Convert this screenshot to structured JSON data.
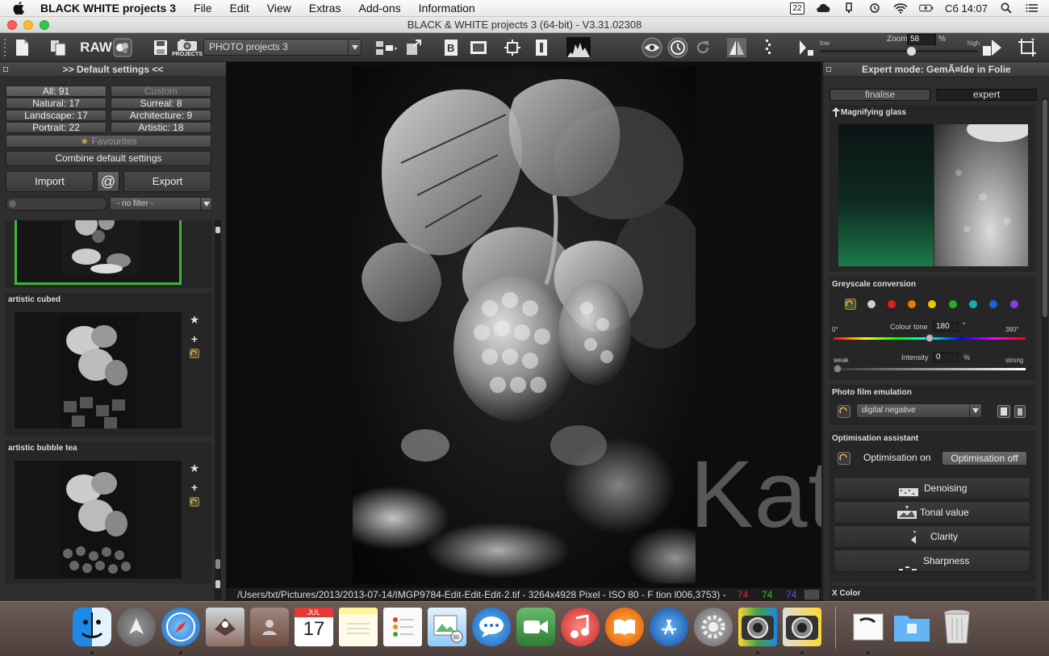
{
  "menubar": {
    "app_name": "BLACK WHITE projects 3",
    "items": [
      "File",
      "Edit",
      "View",
      "Extras",
      "Add-ons",
      "Information"
    ],
    "badge": "22",
    "clock": "Сб 14:07"
  },
  "window": {
    "title": "BLACK & WHITE projects 3 (64-bit) - V3.31.02308"
  },
  "toolbar": {
    "raw_label": "RAW",
    "projects_label": "PROJECTS",
    "project_combo": "PHOTO projects 3",
    "zoom_label": "Zoom",
    "zoom_value": "58",
    "zoom_unit": "%",
    "zoom_low": "low",
    "zoom_high": "high",
    "zoom_level_percent": 58
  },
  "left_panel": {
    "title": ">> Default settings <<",
    "categories": [
      {
        "label": "All: 91",
        "selected": true
      },
      {
        "label": "Custom",
        "selected": false
      },
      {
        "label": "Natural: 17"
      },
      {
        "label": "Surreal: 8"
      },
      {
        "label": "Landscape: 17"
      },
      {
        "label": "Architecture: 9"
      },
      {
        "label": "Portrait: 22"
      },
      {
        "label": "Artistic: 18"
      }
    ],
    "favourites_label": "Favourites",
    "combine_label": "Combine default settings",
    "import_label": "Import",
    "at_label": "@",
    "export_label": "Export",
    "filter_value": "- no filter -",
    "presets": [
      {
        "name": ""
      },
      {
        "name": "artistic cubed"
      },
      {
        "name": "artistic bubble tea"
      }
    ]
  },
  "status": {
    "path": "/Users/txt/Pictures/2013/2013-07-14/IMGP9784-Edit-Edit-Edit-2.tif - 3264x4928 Pixel   - ISO 80 - F  tion  l006,3753) -",
    "r": "74",
    "g": "74",
    "b": "74"
  },
  "watermark": "Kat©",
  "right_panel": {
    "title": "Expert mode: GemÃ¤lde in Folie",
    "tab_finalise": "finalise",
    "tab_expert": "expert",
    "magnifier_title": "Magnifying glass",
    "greyscale": {
      "title": "Greyscale conversion",
      "colour_tone_label": "Colour tone",
      "colour_tone_value": "180",
      "colour_tone_unit": "°",
      "min_label": "0°",
      "max_label": "360°",
      "intensity_label": "Intensity",
      "intensity_value": "0",
      "intensity_unit": "%",
      "weak_label": "weak",
      "strong_label": "strong",
      "colour_tone_fraction": 0.5,
      "intensity_fraction": 0.0,
      "dots": [
        "#cfcfcf",
        "#e02020",
        "#f07800",
        "#e8c800",
        "#20b020",
        "#10b0b0",
        "#2060e0",
        "#8040e0"
      ]
    },
    "film": {
      "title": "Photo film emulation",
      "value": "digital negative"
    },
    "optimisation": {
      "title": "Optimisation assistant",
      "on_label": "Optimisation on",
      "off_label": "Optimisation off",
      "rows": [
        "Denoising",
        "Tonal value",
        "Clarity",
        "Sharpness"
      ]
    },
    "xcolor_title": "X Color"
  },
  "dock": {
    "calendar_month": "JUL",
    "calendar_day": "17",
    "clock_badge": "30"
  }
}
